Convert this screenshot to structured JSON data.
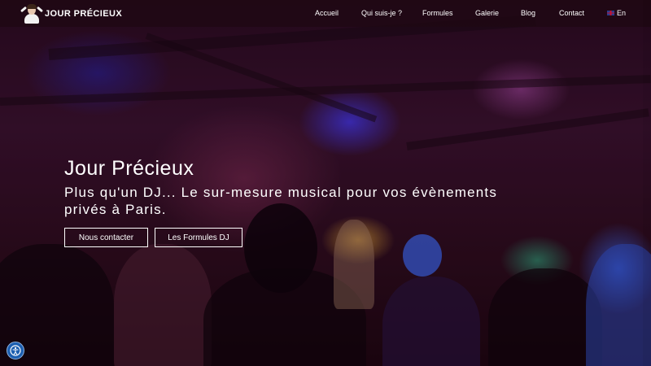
{
  "brand": {
    "name": "JOUR PRÉCIEUX"
  },
  "nav": {
    "items": [
      {
        "label": "Accueil"
      },
      {
        "label": "Qui suis-je ?"
      },
      {
        "label": "Formules"
      },
      {
        "label": "Galerie"
      },
      {
        "label": "Blog"
      },
      {
        "label": "Contact"
      }
    ],
    "language": {
      "label": "En",
      "icon": "uk-flag-icon"
    }
  },
  "hero": {
    "title": "Jour Précieux",
    "subtitle": "Plus qu'un DJ... Le sur-mesure musical pour vos évènements privés à Paris.",
    "buttons": {
      "contact": "Nous contacter",
      "formules": "Les Formules DJ"
    },
    "background": "photo of a dancing crowd under blue, purple and orange party lights"
  },
  "widgets": {
    "accessibility": {
      "icon": "accessibility-icon",
      "color": "#1c5fb0"
    }
  },
  "colors": {
    "navbar": "#1e0812",
    "text": "#ffffff",
    "accent_blue": "#4636ff"
  }
}
